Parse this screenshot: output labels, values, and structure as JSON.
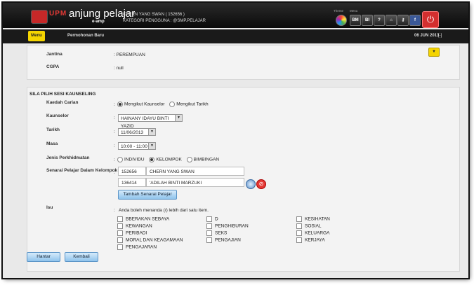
{
  "header": {
    "brand_letters": "UPM",
    "app_name": "anjung pelajar",
    "app_sub": "e-amp",
    "user_name": "CHERN YANG SWAN ( 152656 )",
    "user_category": "KATEGORI PENGGUNA : @SMP.PELAJAR",
    "theme_label": "Theme",
    "menu_label": "Menu",
    "bm": "BM",
    "bi": "BI",
    "help": "?",
    "home": "⌂",
    "key": "⚷",
    "facebook": "f",
    "power": "⏻"
  },
  "menubar": {
    "menu": "Menu",
    "permohonan_baru": "Permohonan Baru",
    "date": "06 JUN 2013",
    "toggle": "[-]"
  },
  "student": {
    "jantina_label": "Jantina",
    "jantina_value": ": PEREMPUAN",
    "cgpa_label": "CGPA",
    "cgpa_value": ": null",
    "collapse": "▼"
  },
  "form": {
    "section_title": "SILA PILIH SESI KAUNSELING",
    "kaedah_label": "Kaedah Carian",
    "kaedah_opts": [
      "Mengikut Kaunselor",
      "Mengikut Tarikh"
    ],
    "kaunselor_label": "Kaunselor",
    "kaunselor_value": "HAINANY IDAYU BINTI YAZID",
    "tarikh_label": "Tarikh",
    "tarikh_value": "11/06/2013",
    "masa_label": "Masa",
    "masa_value": "10:00 - 11:00",
    "jenis_label": "Jenis Perkhidmatan",
    "jenis_opts": [
      "INDIVIDU",
      "KELOMPOK",
      "BIMBINGAN"
    ],
    "senarai_label": "Senarai Pelajar Dalam Kelompok",
    "students": [
      {
        "id": "152656",
        "name": "CHERN YANG SWAN"
      },
      {
        "id": "136414",
        "name": "'ADILAH BINTI MARZUKI"
      }
    ],
    "tambah_button": "Tambah Senarai Pelajar",
    "colon": ":",
    "isu_label": "Isu",
    "isu_note": "Anda boleh menanda (/) lebih dari satu item.",
    "isu_col1": [
      "BBERAKAN SEBAYA",
      "KEWANGAN",
      "PERIBADI",
      "MORAL DAN KEAGAMAAN",
      "PENGAJARAN"
    ],
    "isu_col2": [
      "D",
      "PENGHIBURAN",
      "SEKS",
      "PENGAJIAN"
    ],
    "isu_col3": [
      "KESIHATAN",
      "SOSIAL",
      "KELUARGA",
      "KERJAYA"
    ],
    "hantar_button": "Hantar",
    "kembali_button": "Kembali"
  }
}
